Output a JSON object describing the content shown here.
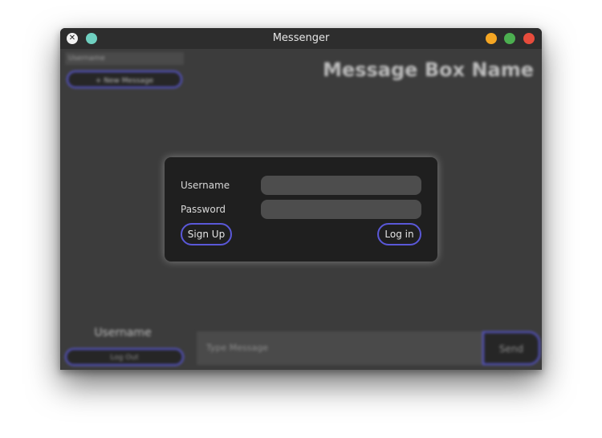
{
  "window": {
    "title": "Messenger"
  },
  "titlebar": {
    "app_icon": "x-logo-icon",
    "left_dot": "teal-dot-icon",
    "controls": {
      "minimize": "minimize-dot-icon",
      "maximize": "maximize-dot-icon",
      "close": "close-dot-icon"
    }
  },
  "sidebar": {
    "header_label": "Username",
    "new_message_label": "+ New Message",
    "username": "Username",
    "logout_label": "Log Out"
  },
  "main": {
    "message_box_name": "Message Box Name",
    "message_placeholder": "Type Message",
    "send_label": "Send"
  },
  "login_dialog": {
    "username_label": "Username",
    "username_value": "",
    "password_label": "Password",
    "password_value": "",
    "signup_label": "Sign Up",
    "login_label": "Log in"
  },
  "colors": {
    "accent_border": "#5a58d8",
    "background": "#3c3c3c",
    "dialog_bg": "#1f1f1f"
  }
}
